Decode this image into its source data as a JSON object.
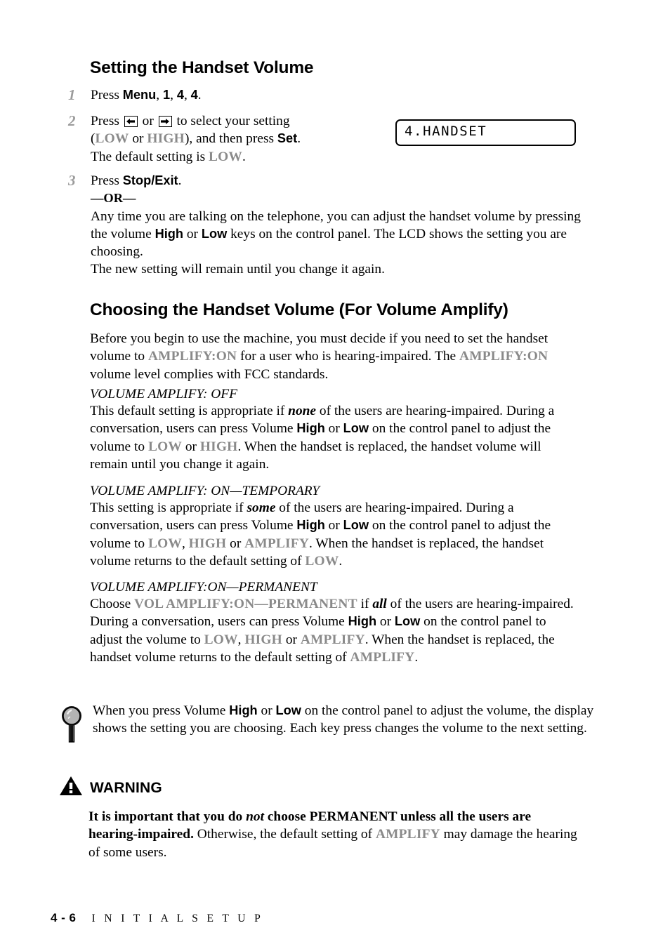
{
  "page": {
    "section_heading_1": "Setting the Handset Volume",
    "section_heading_2": "Choosing the Handset Volume (For Volume Amplify)"
  },
  "colors": {
    "lcd_word_grey": "#8a8a8a",
    "step_number_grey": "#9b9b9b",
    "text_black": "#000000",
    "page_background": "#ffffff"
  },
  "steps": [
    {
      "number": "1",
      "lines": [
        {
          "t": "Press ",
          "s": "plain"
        },
        {
          "t": "Menu",
          "s": "ui"
        },
        {
          "t": ", ",
          "s": "plain"
        },
        {
          "t": "1",
          "s": "ui"
        },
        {
          "t": ", ",
          "s": "plain"
        },
        {
          "t": "4",
          "s": "ui"
        },
        {
          "t": ", ",
          "s": "plain"
        },
        {
          "t": "4",
          "s": "ui"
        },
        {
          "t": ".",
          "s": "plain"
        }
      ]
    },
    {
      "number": "2",
      "text_a": "Press ",
      "text_b": " or ",
      "text_c": " to select your setting",
      "text_d": "(",
      "low": "LOW",
      "text_e": " or ",
      "high": "HIGH",
      "text_f": "), and then press ",
      "set": "Set",
      "text_g": ".",
      "text_h": "The default setting is ",
      "low2": "LOW",
      "text_i": "."
    },
    {
      "number": "3",
      "press": "Press ",
      "stop_exit": "Stop/Exit",
      "period": ".",
      "or": "—OR—",
      "para_a": "Any time you are talking on the telephone, you can adjust the handset volume by pressing the volume ",
      "high": "High",
      "para_b": " or ",
      "low": "Low",
      "para_c": " keys on the control panel. The LCD shows the setting you are choosing.",
      "para_d": "The new setting will remain until you change it again."
    }
  ],
  "lcd": {
    "display_text": "4.HANDSET"
  },
  "intro": {
    "a": "Before you begin to use the machine, you must decide if you need to set the handset volume to ",
    "amplify_on_1": "AMPLIFY:ON",
    "b": " for a user who is hearing-impaired. The ",
    "amplify_on_2": "AMPLIFY:ON",
    "c": " volume level complies with FCC standards."
  },
  "modes": [
    {
      "subhead": "VOLUME AMPLIFY: OFF",
      "a": "This default setting is appropriate if ",
      "em": "none",
      "b": " of the users are hearing-impaired. During a conversation, users can press Volume ",
      "key_high": "High",
      "c": " or ",
      "key_low": "Low",
      "d": " on the control panel to adjust the volume to ",
      "lcd_1": "LOW",
      "e": " or ",
      "lcd_2": "HIGH",
      "f": ". When the handset is replaced, the handset volume will remain until you change it again."
    },
    {
      "subhead": "VOLUME AMPLIFY: ON—TEMPORARY",
      "a": "This setting is appropriate if ",
      "em": "some",
      "b": " of the users are hearing-impaired. During a conversation, users can press Volume ",
      "key_high": "High",
      "c": " or ",
      "key_low": "Low",
      "d": " on the control panel to adjust the volume to ",
      "lcd_1": "LOW",
      "e": ", ",
      "lcd_2": "HIGH",
      "f": " or ",
      "lcd_3": "AMPLIFY",
      "g": ". When the handset is replaced, the handset volume returns to the default setting of ",
      "lcd_4": "LOW",
      "h": "."
    },
    {
      "subhead": "VOLUME AMPLIFY:ON—PERMANENT",
      "a": "Choose ",
      "lcd_0": "VOL AMPLIFY:ON—PERMANENT",
      "b": " if ",
      "em": "all",
      "c": " of the users are hearing-impaired. During a conversation, users can press Volume ",
      "key_high": "High",
      "d": " or ",
      "key_low": "Low",
      "e": " on the control panel to adjust the volume to ",
      "lcd_1": "LOW",
      "f": ", ",
      "lcd_2": "HIGH",
      "g": " or ",
      "lcd_3": "AMPLIFY",
      "h": ". When the handset is replaced, the handset volume returns to the default setting of ",
      "lcd_4": "AMPLIFY",
      "i": "."
    }
  ],
  "note": {
    "icon": "magnifier-icon",
    "a": "When you press Volume ",
    "key_high": "High",
    "b": " or ",
    "key_low": "Low",
    "c": " on the control panel to adjust the volume, the display shows the setting you are choosing. Each key press changes the volume to the next setting."
  },
  "warning": {
    "icon": "warning-triangle-icon",
    "label": "WARNING",
    "a": "It is important that you do ",
    "em": "not",
    "b": " choose PERMANENT unless all the users are hearing-impaired.",
    "c": " Otherwise, the default setting of ",
    "lcd": "AMPLIFY",
    "d": " may damage the hearing of some users."
  },
  "footer": {
    "page_number": "4 - 6",
    "section": "I N I T I A L   S E T U P"
  }
}
